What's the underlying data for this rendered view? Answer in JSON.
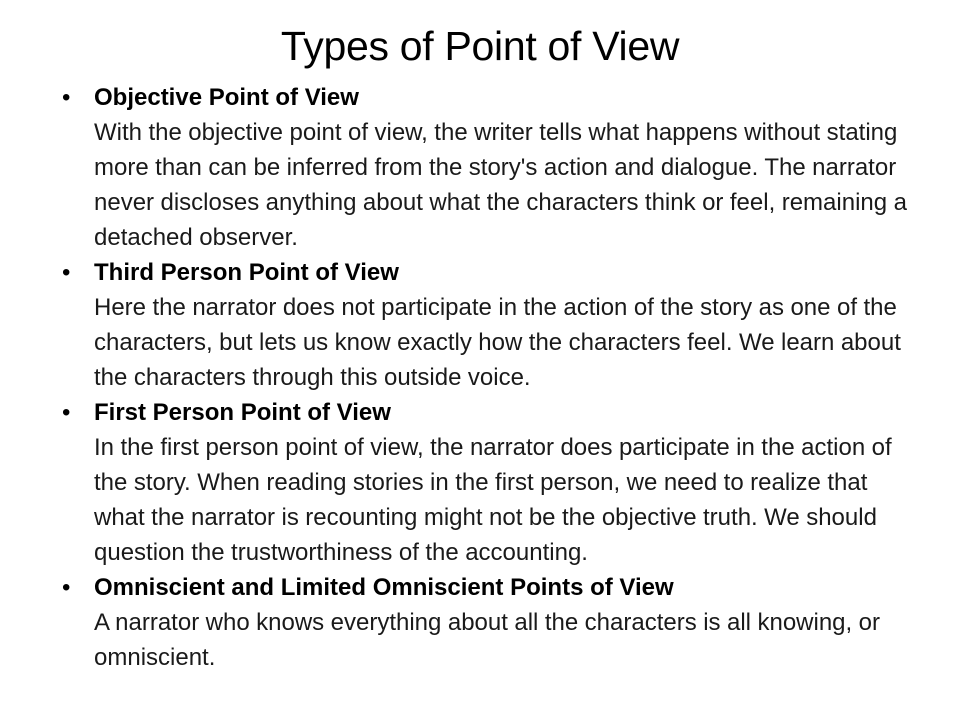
{
  "slide": {
    "title": "Types of Point of View",
    "background_color": "#ffffff",
    "text_color": "#000000",
    "bullet_glyph": "•",
    "bullets": [
      {
        "heading": "Objective Point of View",
        "body": "With the objective point of view, the writer tells what happens without stating more than can be inferred from the story's action and dialogue. The narrator never discloses anything about what the characters think or feel, remaining a detached observer."
      },
      {
        "heading": "Third Person Point of View",
        "body": "Here the narrator does not participate in the action of the story as one of the characters, but lets us know exactly how the characters feel. We learn about the characters through this outside voice."
      },
      {
        "heading": "First Person Point of View",
        "body": "In the first person point of view, the narrator does participate in the action of the story. When reading stories in the first person, we need to realize that what the narrator is recounting might not be the objective truth. We should question the trustworthiness of the accounting."
      },
      {
        "heading": "Omniscient and Limited Omniscient Points of View",
        "body": "A narrator who knows everything about all the characters is all knowing, or omniscient."
      }
    ]
  }
}
